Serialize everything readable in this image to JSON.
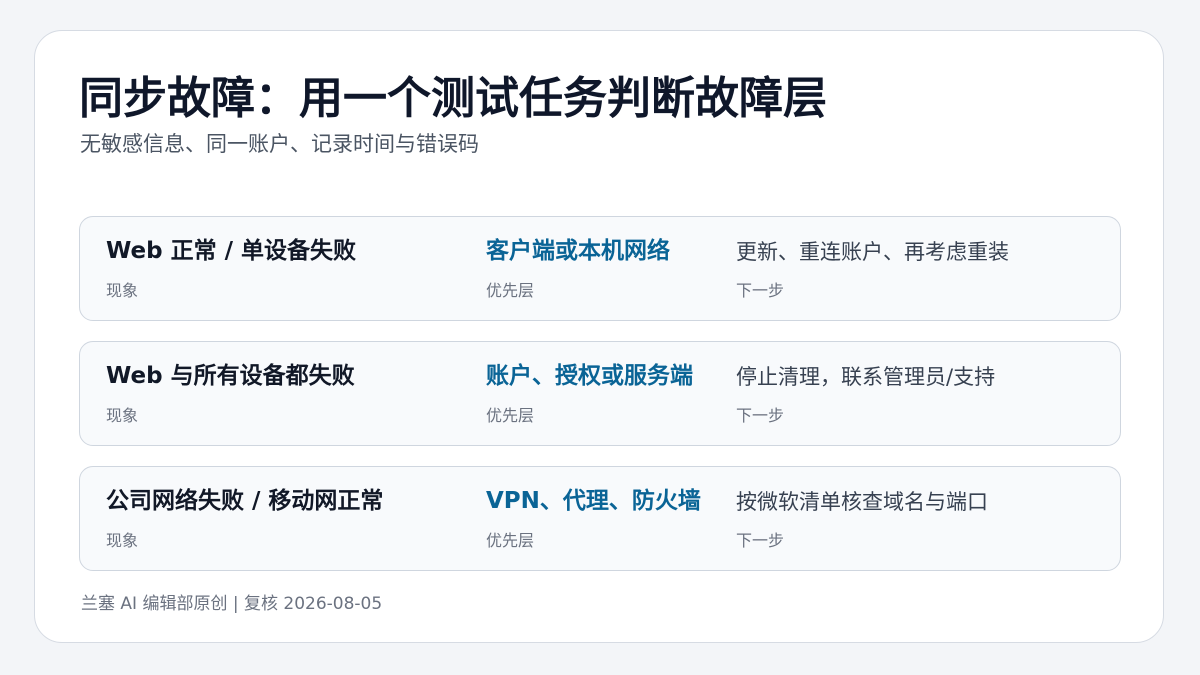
{
  "title": "同步故障：用一个测试任务判断故障层",
  "subtitle": "无敏感信息、同一账户、记录时间与错误码",
  "labels": {
    "phenomenon": "现象",
    "layer": "优先层",
    "next_step": "下一步"
  },
  "rows": [
    {
      "phenomenon": "Web 正常 / 单设备失败",
      "layer": "客户端或本机网络",
      "next_step": "更新、重连账户、再考虑重装"
    },
    {
      "phenomenon": "Web 与所有设备都失败",
      "layer": "账户、授权或服务端",
      "next_step": "停止清理，联系管理员/支持"
    },
    {
      "phenomenon": "公司网络失败 / 移动网正常",
      "layer": "VPN、代理、防火墙",
      "next_step": "按微软清单核查域名与端口"
    }
  ],
  "footer": "兰塞 AI 编辑部原创 | 复核 2026-08-05",
  "colors": {
    "accent": "#0a6496",
    "title": "#0f172a",
    "muted": "#6b7280"
  }
}
